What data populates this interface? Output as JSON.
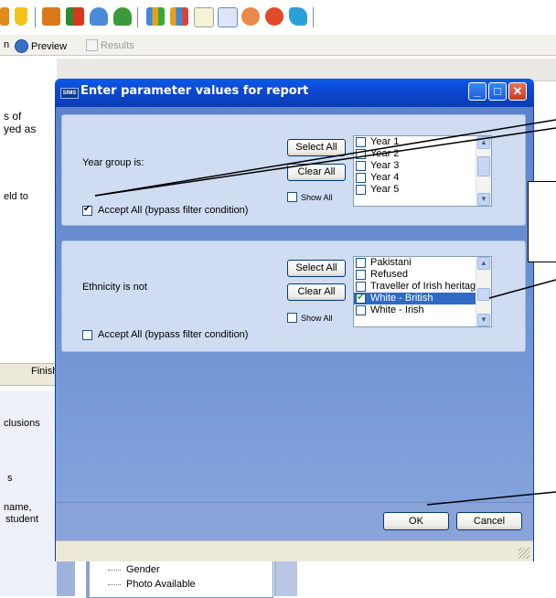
{
  "toolbar": {
    "icons": [
      "report-icon",
      "trophy-icon",
      "book-icon",
      "flag-icon",
      "people-icon",
      "group-icon",
      "chart-icon",
      "chart-alt-icon",
      "document-icon",
      "edit-icon",
      "users-icon",
      "clock-icon",
      "transfer-icon"
    ]
  },
  "tabbar": {
    "partial_left": "n",
    "preview_label": "Preview",
    "results_label": "Results"
  },
  "left_panel": {
    "text_lines": [
      "s of",
      "yed as"
    ],
    "held_to": "eld to",
    "finish_label": "Finish",
    "exclusions": "clusions",
    "s_text": "s",
    "name_line": "name,",
    "student_line": "student"
  },
  "tree": {
    "items": [
      "Gender",
      "Photo Available"
    ]
  },
  "dialog": {
    "badge": "SIMS",
    "title": "Enter parameter values for report",
    "controls": {
      "minimize": "_",
      "maximize": "□",
      "close": "✕"
    },
    "sections": [
      {
        "condition_label": "Year group is:",
        "select_all_label": "Select All",
        "clear_all_label": "Clear All",
        "show_all_label": "Show All",
        "show_all_checked": false,
        "accept_all_label": "Accept All (bypass filter condition)",
        "accept_all_checked": true,
        "items": [
          {
            "label": "Year 1",
            "checked": false,
            "selected": false
          },
          {
            "label": "Year 2",
            "checked": false,
            "selected": false
          },
          {
            "label": "Year 3",
            "checked": false,
            "selected": false
          },
          {
            "label": "Year 4",
            "checked": false,
            "selected": false
          },
          {
            "label": "Year 5",
            "checked": false,
            "selected": false
          }
        ]
      },
      {
        "condition_label": "Ethnicity is not",
        "select_all_label": "Select All",
        "clear_all_label": "Clear All",
        "show_all_label": "Show All",
        "show_all_checked": false,
        "accept_all_label": "Accept All (bypass filter condition)",
        "accept_all_checked": false,
        "items": [
          {
            "label": "Pakistani",
            "checked": false,
            "selected": false
          },
          {
            "label": "Refused",
            "checked": false,
            "selected": false
          },
          {
            "label": "Traveller of Irish heritage",
            "checked": false,
            "selected": false
          },
          {
            "label": "White - British",
            "checked": true,
            "selected": true
          },
          {
            "label": "White - Irish",
            "checked": false,
            "selected": false
          }
        ]
      }
    ],
    "ok_label": "OK",
    "cancel_label": "Cancel"
  }
}
